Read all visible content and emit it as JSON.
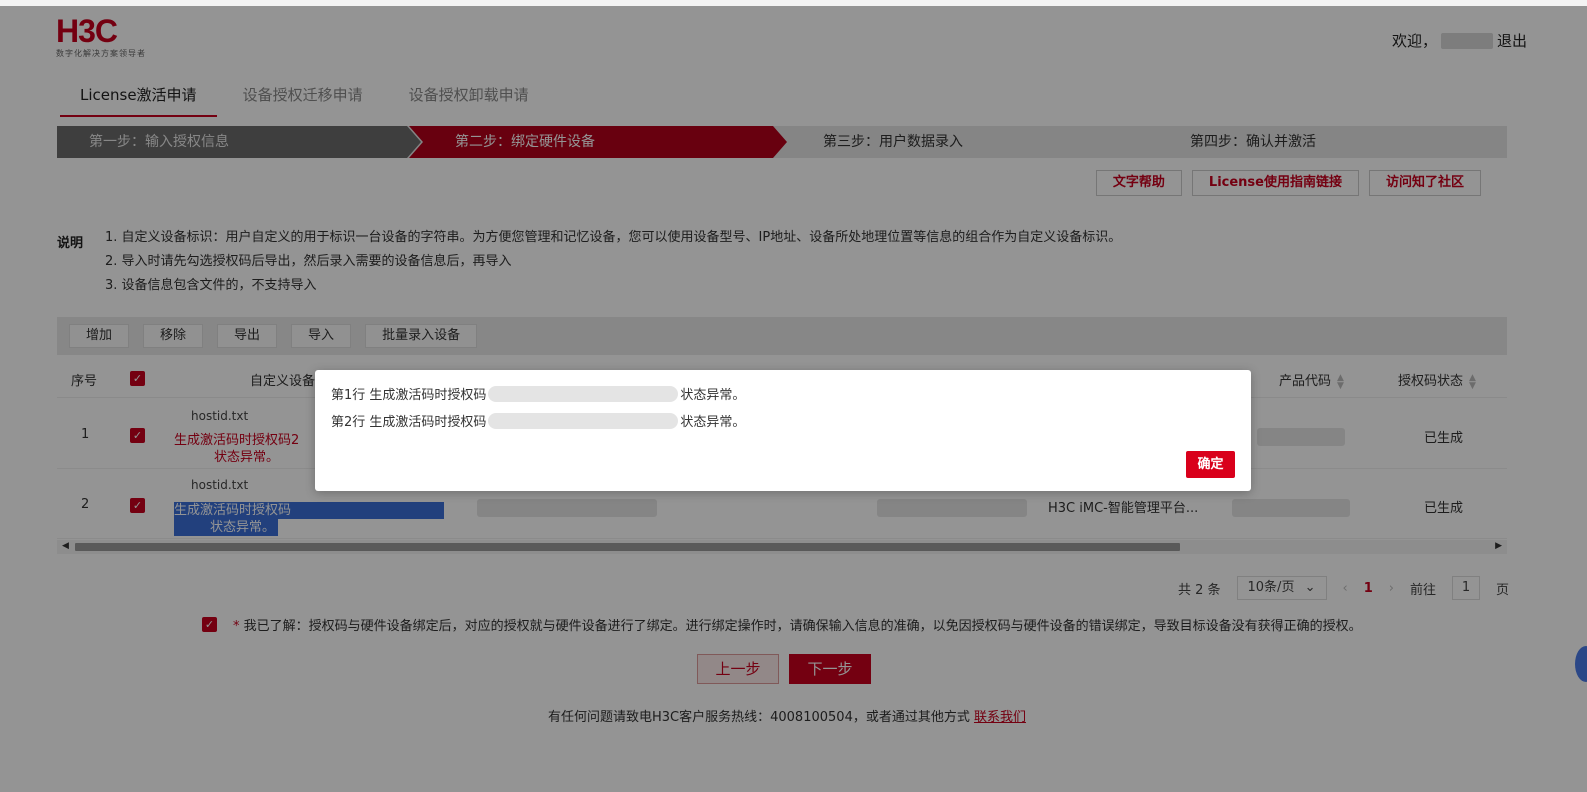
{
  "brand": {
    "logo": "H3C",
    "tagline": "数字化解决方案领导者"
  },
  "header": {
    "welcome": "欢迎，",
    "logout": "退出"
  },
  "tabs": [
    {
      "label": "License激活申请",
      "active": true
    },
    {
      "label": "设备授权迁移申请",
      "active": false
    },
    {
      "label": "设备授权卸载申请",
      "active": false
    }
  ],
  "steps": [
    {
      "label": "第一步：输入授权信息"
    },
    {
      "label": "第二步：绑定硬件设备"
    },
    {
      "label": "第三步：用户数据录入"
    },
    {
      "label": "第四步：确认并激活"
    }
  ],
  "help_buttons": [
    "文字帮助",
    "License使用指南链接",
    "访问知了社区"
  ],
  "notes": {
    "label": "说明",
    "items": [
      "1. 自定义设备标识：用户自定义的用于标识一台设备的字符串。为方便您管理和记忆设备，您可以使用设备型号、IP地址、设备所处地理位置等信息的组合作为自定义设备标识。",
      "2. 导入时请先勾选授权码后导出，然后录入需要的设备信息后，再导入",
      "3. 设备信息包含文件的，不支持导入"
    ]
  },
  "toolbar": [
    "增加",
    "移除",
    "导出",
    "导入",
    "批量录入设备"
  ],
  "table": {
    "headers": {
      "index": "序号",
      "custom_id": "自定义设备",
      "product_code": "产品代码",
      "auth_status": "授权码状态"
    },
    "rows": [
      {
        "index": "1",
        "file": "hostid.txt",
        "error_a": "生成激活码时授权码2",
        "error_b": "状态异常。",
        "product": "",
        "status": "已生成"
      },
      {
        "index": "2",
        "file": "hostid.txt",
        "error_a": "生成激活码时授权码",
        "error_b": "状态异常。",
        "product": "H3C iMC-智能管理平台...",
        "status": "已生成"
      }
    ]
  },
  "pager": {
    "total": "共 2 条",
    "page_size": "10条/页",
    "current": "1",
    "goto_label": "前往",
    "goto_value": "1",
    "page_unit": "页"
  },
  "agreement": {
    "star": "*",
    "text": "我已了解：授权码与硬件设备绑定后，对应的授权就与硬件设备进行了绑定。进行绑定操作时，请确保输入信息的准确，以免因授权码与硬件设备的错误绑定，导致目标设备没有获得正确的授权。"
  },
  "nav": {
    "prev": "上一步",
    "next": "下一步"
  },
  "footer": {
    "text": "有任何问题请致电H3C客户服务热线：4008100504，或者通过其他方式 ",
    "link": "联系我们"
  },
  "dialog": {
    "line1_pre": "第1行 生成激活码时授权码",
    "line1_post": "状态异常。",
    "line2_pre": "第2行 生成激活码时授权码",
    "line2_post": "状态异常。",
    "ok": "确定"
  },
  "colors": {
    "brand_red": "#c8001e",
    "step_active": "#b3001b",
    "step_done": "#6b6b6b"
  }
}
